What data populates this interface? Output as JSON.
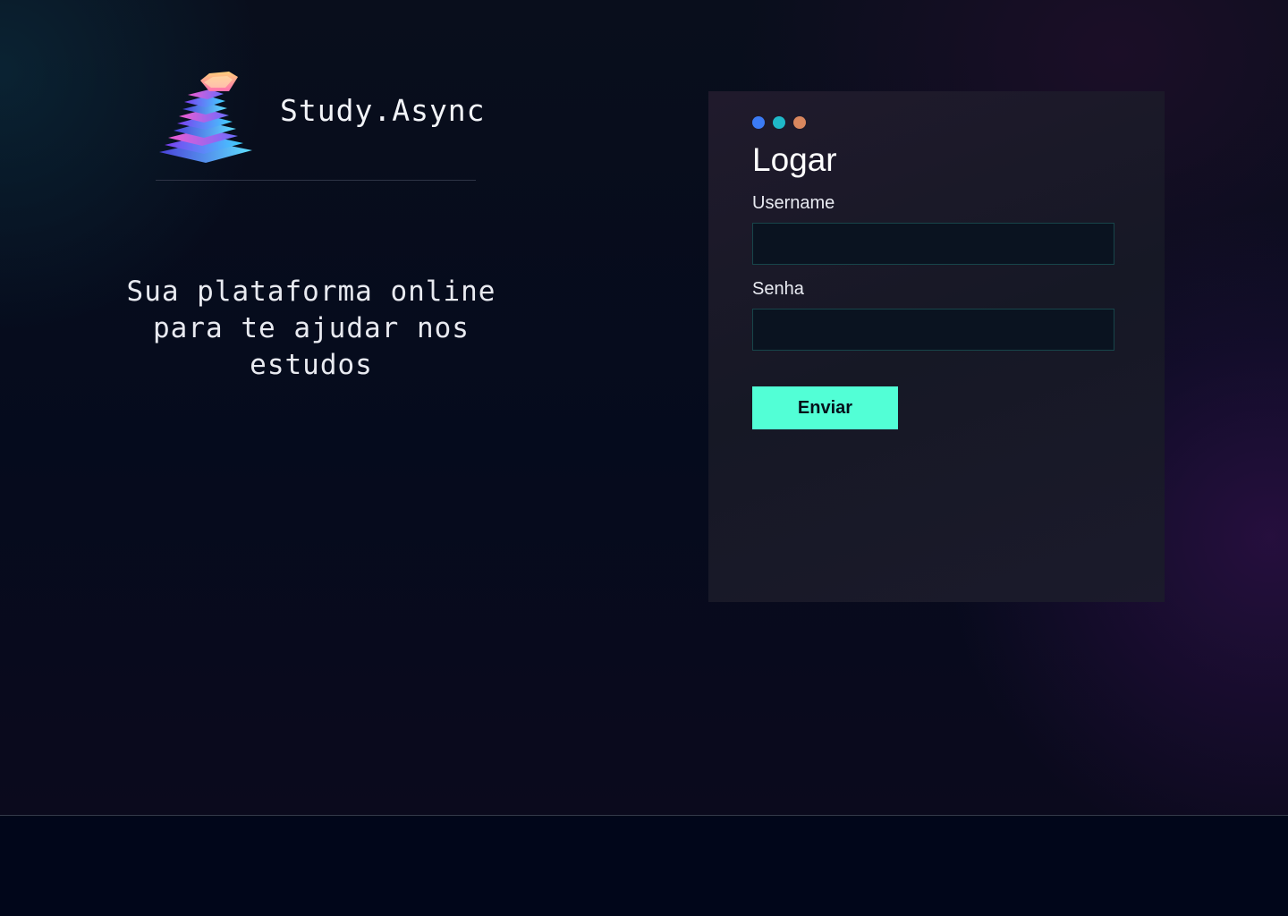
{
  "brand": {
    "name": "Study.Async",
    "logo_icon": "books-stack-icon"
  },
  "tagline": {
    "line1": "Sua plataforma online",
    "line2": "para te ajudar nos estudos"
  },
  "login": {
    "title": "Logar",
    "dots": [
      "#3b7bf5",
      "#1fb8c8",
      "#d9875e"
    ],
    "username": {
      "label": "Username",
      "value": "",
      "placeholder": ""
    },
    "password": {
      "label": "Senha",
      "value": "",
      "placeholder": ""
    },
    "submit_label": "Enviar"
  },
  "colors": {
    "accent": "#52ffd6",
    "input_border": "#17454a"
  }
}
